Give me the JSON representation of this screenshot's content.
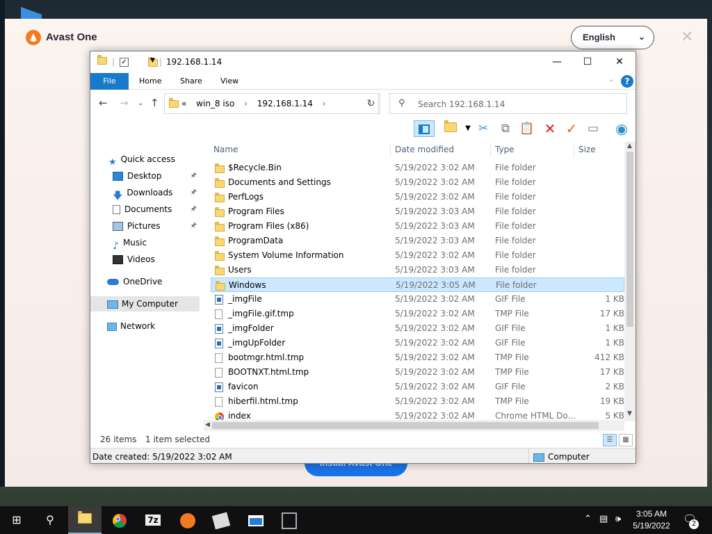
{
  "avast": {
    "title": "Avast One",
    "language": "English",
    "install_button": "Install Avast One"
  },
  "explorer": {
    "window_title": "192.168.1.14",
    "ribbon_tabs": [
      "File",
      "Home",
      "Share",
      "View"
    ],
    "breadcrumb_prefix": "«",
    "breadcrumbs": [
      "win_8 iso",
      "192.168.1.14"
    ],
    "search_placeholder": "Search 192.168.1.14",
    "nav": {
      "quick_access": "Quick access",
      "desktop": "Desktop",
      "downloads": "Downloads",
      "documents": "Documents",
      "pictures": "Pictures",
      "music": "Music",
      "videos": "Videos",
      "onedrive": "OneDrive",
      "my_computer": "My Computer",
      "network": "Network"
    },
    "columns": {
      "name": "Name",
      "date": "Date modified",
      "type": "Type",
      "size": "Size"
    },
    "files": [
      {
        "name": "$Recycle.Bin",
        "date": "5/19/2022 3:02 AM",
        "type": "File folder",
        "size": "",
        "icon": "folder"
      },
      {
        "name": "Documents and Settings",
        "date": "5/19/2022 3:02 AM",
        "type": "File folder",
        "size": "",
        "icon": "folder"
      },
      {
        "name": "PerfLogs",
        "date": "5/19/2022 3:02 AM",
        "type": "File folder",
        "size": "",
        "icon": "folder"
      },
      {
        "name": "Program Files",
        "date": "5/19/2022 3:03 AM",
        "type": "File folder",
        "size": "",
        "icon": "folder"
      },
      {
        "name": "Program Files (x86)",
        "date": "5/19/2022 3:03 AM",
        "type": "File folder",
        "size": "",
        "icon": "folder"
      },
      {
        "name": "ProgramData",
        "date": "5/19/2022 3:03 AM",
        "type": "File folder",
        "size": "",
        "icon": "folder"
      },
      {
        "name": "System Volume Information",
        "date": "5/19/2022 3:02 AM",
        "type": "File folder",
        "size": "",
        "icon": "folder"
      },
      {
        "name": "Users",
        "date": "5/19/2022 3:03 AM",
        "type": "File folder",
        "size": "",
        "icon": "folder"
      },
      {
        "name": "Windows",
        "date": "5/19/2022 3:05 AM",
        "type": "File folder",
        "size": "",
        "icon": "folder",
        "selected": true
      },
      {
        "name": "_imgFile",
        "date": "5/19/2022 3:02 AM",
        "type": "GIF File",
        "size": "1 KB",
        "icon": "gif"
      },
      {
        "name": "_imgFile.gif.tmp",
        "date": "5/19/2022 3:02 AM",
        "type": "TMP File",
        "size": "17 KB",
        "icon": "file"
      },
      {
        "name": "_imgFolder",
        "date": "5/19/2022 3:02 AM",
        "type": "GIF File",
        "size": "1 KB",
        "icon": "gif"
      },
      {
        "name": "_imgUpFolder",
        "date": "5/19/2022 3:02 AM",
        "type": "GIF File",
        "size": "1 KB",
        "icon": "gif"
      },
      {
        "name": "bootmgr.html.tmp",
        "date": "5/19/2022 3:02 AM",
        "type": "TMP File",
        "size": "412 KB",
        "icon": "file"
      },
      {
        "name": "BOOTNXT.html.tmp",
        "date": "5/19/2022 3:02 AM",
        "type": "TMP File",
        "size": "17 KB",
        "icon": "file"
      },
      {
        "name": "favicon",
        "date": "5/19/2022 3:02 AM",
        "type": "GIF File",
        "size": "2 KB",
        "icon": "gif"
      },
      {
        "name": "hiberfil.html.tmp",
        "date": "5/19/2022 3:02 AM",
        "type": "TMP File",
        "size": "19 KB",
        "icon": "file"
      },
      {
        "name": "index",
        "date": "5/19/2022 3:02 AM",
        "type": "Chrome HTML Do...",
        "size": "5 KB",
        "icon": "chrome"
      }
    ],
    "status_count": "26 items",
    "status_selected": "1 item selected",
    "details_created": "Date created: 5/19/2022 3:02 AM",
    "details_location": "Computer"
  },
  "taskbar": {
    "time": "3:05 AM",
    "date": "5/19/2022",
    "notifications": "2"
  }
}
